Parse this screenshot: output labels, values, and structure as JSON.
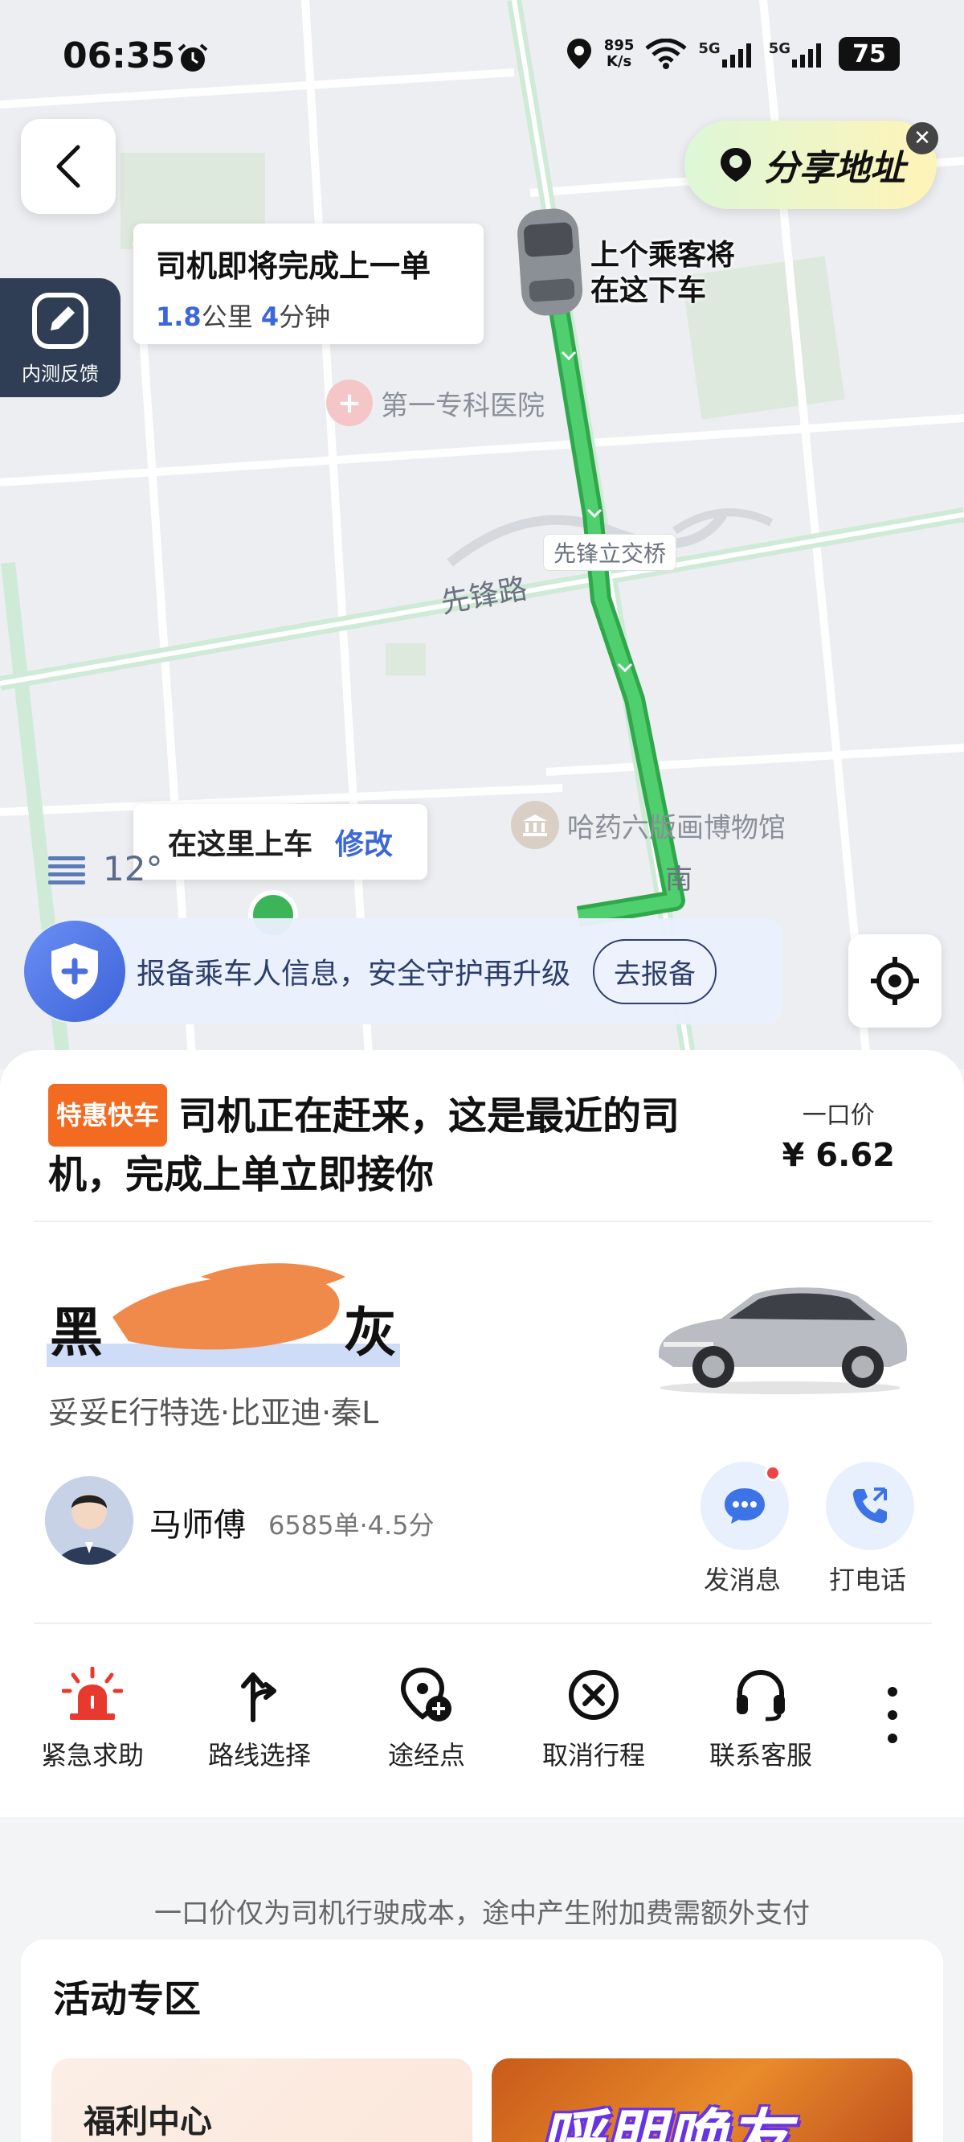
{
  "status_bar": {
    "time": "06:35",
    "net_speed_value": "895",
    "net_speed_unit": "K/s",
    "signal1": "5G",
    "signal2": "5G",
    "battery": "75"
  },
  "map": {
    "share_label": "分享地址",
    "feedback_label": "内测反馈",
    "eta": {
      "title": "司机即将完成上一单",
      "distance": "1.8",
      "distance_unit": "公里",
      "minutes": "4",
      "minutes_unit": "分钟"
    },
    "car_label_line1": "上个乘客将",
    "car_label_line2": "在这下车",
    "poi_hospital": "第一专科医院",
    "poi_museum": "哈药六版画博物馆",
    "road_xianfeng": "先锋路",
    "bridge": "先锋立交桥",
    "road_south": "南",
    "pickup_text": "在这里上车",
    "pickup_modify": "修改",
    "weather_temp": "12°",
    "safety_text": "报备乘车人信息，安全守护再升级",
    "safety_button": "去报备"
  },
  "order": {
    "tag": "特惠快车",
    "title": "司机正在赶来，这是最近的司机，完成上单立即接你",
    "price_label": "一口价",
    "price_value": "¥ 6.62"
  },
  "vehicle": {
    "plate_start": "黑",
    "plate_end": "灰",
    "model": "妥妥E行特选·比亚迪·秦L"
  },
  "driver": {
    "name": "马师傅",
    "stats": "6585单·4.5分",
    "message_label": "发消息",
    "call_label": "打电话"
  },
  "toolbar": {
    "sos": "紧急求助",
    "route": "路线选择",
    "waypoint": "途经点",
    "cancel": "取消行程",
    "service": "联系客服"
  },
  "disclaimer": "一口价仅为司机行驶成本，途中产生附加费需额外支付",
  "activity": {
    "title": "活动专区",
    "welfare": "福利中心",
    "promo": "呼朋唤友"
  },
  "colors": {
    "route_green": "#3cc35c",
    "accent_blue": "#3c67d8",
    "tag_orange": "#f26b21",
    "sos_red": "#e8392f"
  }
}
